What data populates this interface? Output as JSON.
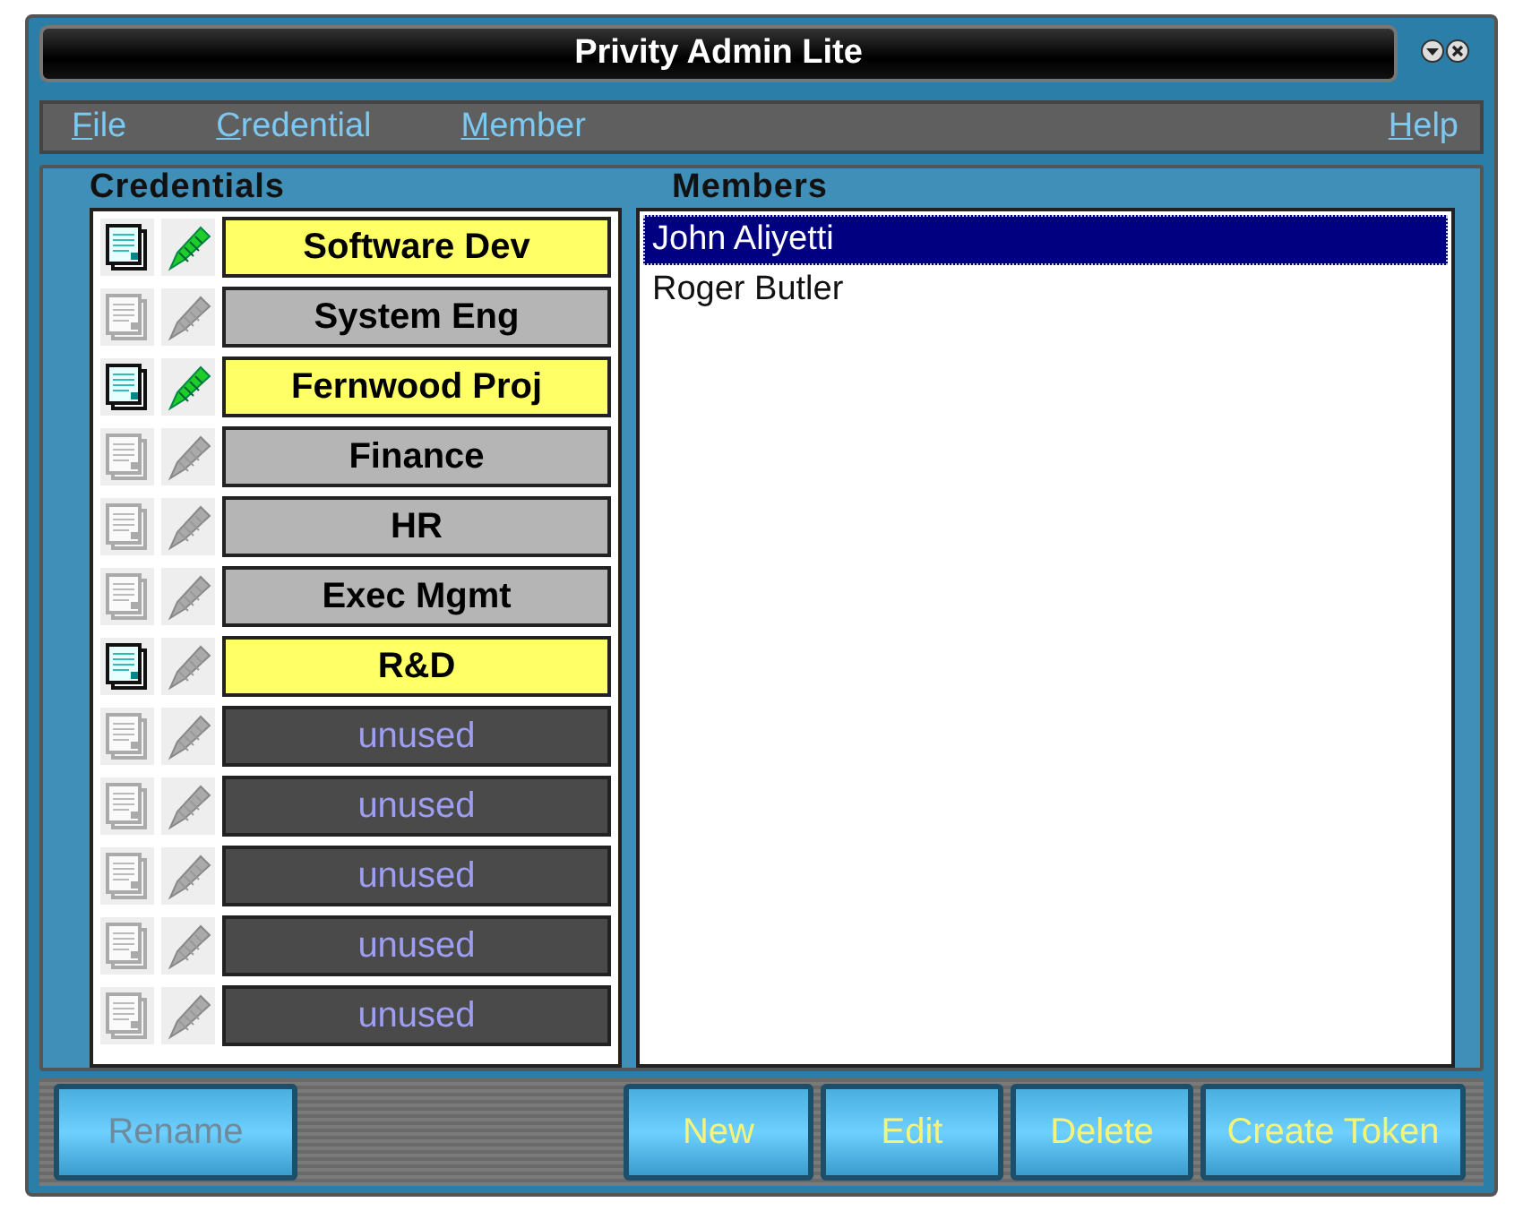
{
  "window": {
    "title": "Privity Admin Lite"
  },
  "menu": [
    {
      "label": "File"
    },
    {
      "label": "Credential"
    },
    {
      "label": "Member"
    },
    {
      "label": "Help"
    }
  ],
  "credentials": {
    "heading": "Credentials",
    "items": [
      {
        "name": "Software Dev",
        "kind": "active",
        "document": true,
        "pen": true
      },
      {
        "name": "System Eng",
        "kind": "inactive",
        "document": false,
        "pen": false
      },
      {
        "name": "Fernwood Proj",
        "kind": "active",
        "document": true,
        "pen": true
      },
      {
        "name": "Finance",
        "kind": "inactive",
        "document": false,
        "pen": false
      },
      {
        "name": "HR",
        "kind": "inactive",
        "document": false,
        "pen": false
      },
      {
        "name": "Exec Mgmt",
        "kind": "inactive",
        "document": false,
        "pen": false
      },
      {
        "name": "R&D",
        "kind": "active",
        "document": true,
        "pen": false
      },
      {
        "name": "unused",
        "kind": "unused",
        "document": false,
        "pen": false
      },
      {
        "name": "unused",
        "kind": "unused",
        "document": false,
        "pen": false
      },
      {
        "name": "unused",
        "kind": "unused",
        "document": false,
        "pen": false
      },
      {
        "name": "unused",
        "kind": "unused",
        "document": false,
        "pen": false
      },
      {
        "name": "unused",
        "kind": "unused",
        "document": false,
        "pen": false
      }
    ]
  },
  "members": {
    "heading": "Members",
    "items": [
      {
        "name": "John Aliyetti",
        "selected": true
      },
      {
        "name": "Roger Butler",
        "selected": false
      }
    ]
  },
  "buttons_left": [
    {
      "label": "Rename",
      "disabled": true
    }
  ],
  "buttons_right": [
    {
      "label": "New",
      "disabled": false
    },
    {
      "label": "Edit",
      "disabled": false
    },
    {
      "label": "Delete",
      "disabled": false
    },
    {
      "label": "Create Token",
      "disabled": false
    }
  ]
}
